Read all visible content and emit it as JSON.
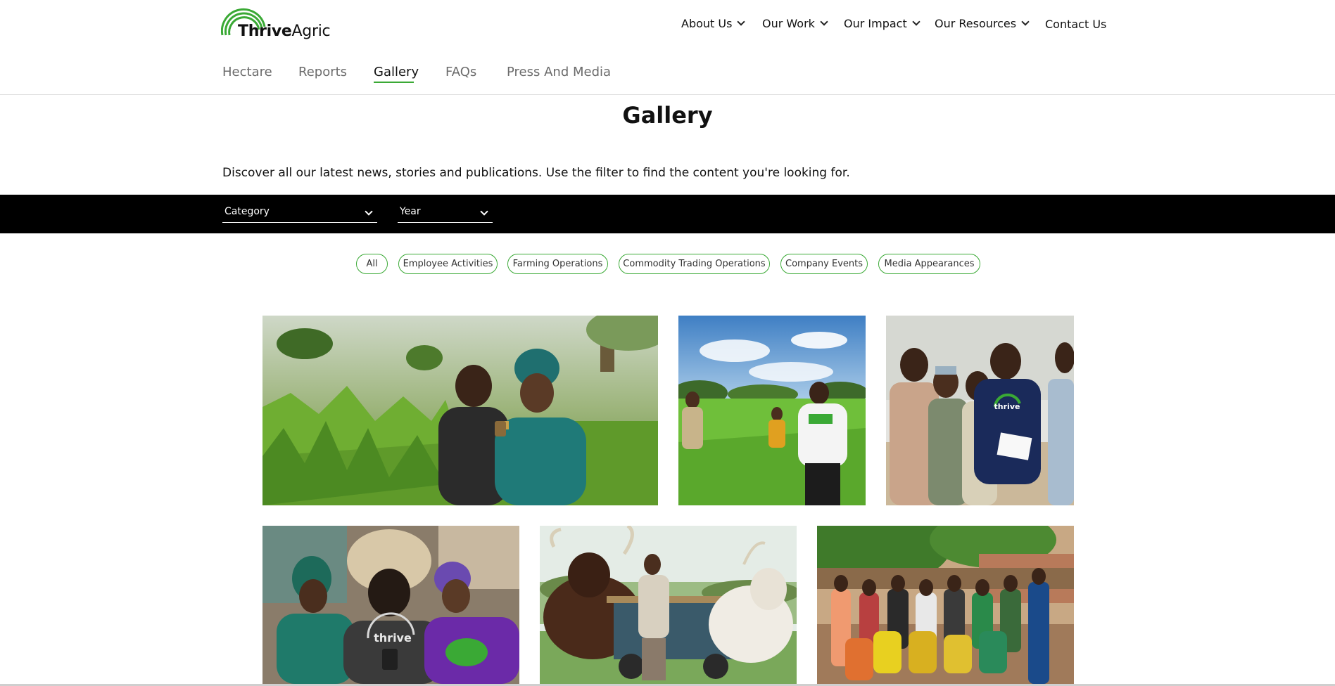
{
  "brand": {
    "name_bold": "Thrive",
    "name_regular": "Agric",
    "primary_color": "#3aa935"
  },
  "main_nav": [
    {
      "label": "About Us",
      "has_dropdown": true
    },
    {
      "label": "Our Work",
      "has_dropdown": true
    },
    {
      "label": "Our Impact",
      "has_dropdown": true
    },
    {
      "label": "Our Resources",
      "has_dropdown": true
    },
    {
      "label": "Contact Us",
      "has_dropdown": false
    }
  ],
  "sub_nav": [
    {
      "label": "Hectare",
      "active": false
    },
    {
      "label": "Reports",
      "active": false
    },
    {
      "label": "Gallery",
      "active": true
    },
    {
      "label": "FAQs",
      "active": false
    },
    {
      "label": "Press And Media",
      "active": false
    }
  ],
  "page": {
    "title": "Gallery",
    "intro": "Discover all our latest news, stories and publications. Use the filter to find the content you're looking for."
  },
  "filters": {
    "category_label": "Category",
    "year_label": "Year"
  },
  "category_pills": [
    "All",
    "Employee Activities",
    "Farming Operations",
    "Commodity Trading Operations",
    "Company Events",
    "Media Appearances"
  ],
  "gallery": [
    {
      "icon": "photo-two-women-phone-maize-field"
    },
    {
      "icon": "photo-farmers-rice-field"
    },
    {
      "icon": "photo-men-thrive-tshirt-documents"
    },
    {
      "icon": "photo-women-looking-at-phone"
    },
    {
      "icon": "photo-man-with-oxen-cart"
    },
    {
      "icon": "photo-group-celebrating-village"
    }
  ],
  "photo_shirt_text": {
    "photo3": "thrive",
    "photo4": "thrive"
  }
}
